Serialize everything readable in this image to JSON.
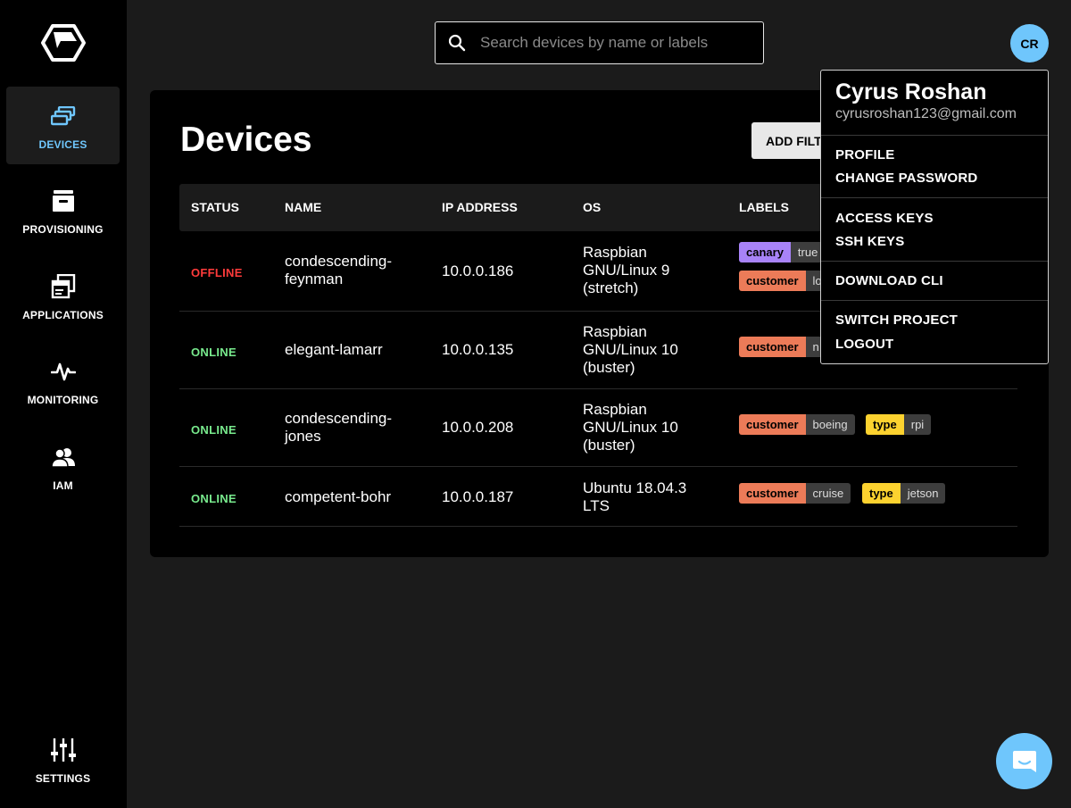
{
  "sidebar": {
    "items": [
      {
        "label": "DEVICES",
        "icon": "devices-icon",
        "active": true
      },
      {
        "label": "PROVISIONING",
        "icon": "archive-box-icon"
      },
      {
        "label": "APPLICATIONS",
        "icon": "applications-icon"
      },
      {
        "label": "MONITORING",
        "icon": "pulse-icon"
      },
      {
        "label": "IAM",
        "icon": "users-icon"
      },
      {
        "label": "SETTINGS",
        "icon": "sliders-icon"
      }
    ]
  },
  "search": {
    "placeholder": "Search devices by name or labels",
    "value": ""
  },
  "avatar": {
    "initials": "CR"
  },
  "main": {
    "title": "Devices",
    "add_filter_label": "ADD FILTER",
    "columns": [
      "STATUS",
      "NAME",
      "IP ADDRESS",
      "OS",
      "LABELS"
    ],
    "rows": [
      {
        "status": "OFFLINE",
        "name": "condescending-\nfeynman",
        "ip": "10.0.0.186",
        "os": "Raspbian\nGNU/Linux 9\n(stretch)",
        "labels": [
          {
            "key": "canary",
            "value": "true"
          },
          {
            "key": "customer",
            "value": "lo"
          }
        ]
      },
      {
        "status": "ONLINE",
        "name": "elegant-lamarr",
        "ip": "10.0.0.135",
        "os": "Raspbian\nGNU/Linux 10\n(buster)",
        "labels": [
          {
            "key": "customer",
            "value": "n"
          }
        ]
      },
      {
        "status": "ONLINE",
        "name": "condescending-\njones",
        "ip": "10.0.0.208",
        "os": "Raspbian\nGNU/Linux 10\n(buster)",
        "labels": [
          {
            "key": "customer",
            "value": "boeing"
          },
          {
            "key": "type",
            "value": "rpi"
          }
        ]
      },
      {
        "status": "ONLINE",
        "name": "competent-bohr",
        "ip": "10.0.0.187",
        "os": "Ubuntu 18.04.3\nLTS",
        "labels": [
          {
            "key": "customer",
            "value": "cruise"
          },
          {
            "key": "type",
            "value": "jetson"
          }
        ]
      }
    ]
  },
  "dropdown": {
    "name": "Cyrus Roshan",
    "email": "cyrusroshan123@gmail.com",
    "items": [
      "PROFILE",
      "CHANGE PASSWORD",
      "ACCESS KEYS",
      "SSH KEYS",
      "DOWNLOAD CLI",
      "SWITCH PROJECT",
      "LOGOUT"
    ]
  },
  "colors": {
    "accent": "#6fc6fc",
    "offline": "#ff3b3b",
    "online": "#78ea8d",
    "label_customer": "#ec7b58",
    "label_canary": "#a883f8",
    "label_type": "#fcd22f"
  },
  "chat": {
    "icon": "chat-bubble-icon"
  }
}
